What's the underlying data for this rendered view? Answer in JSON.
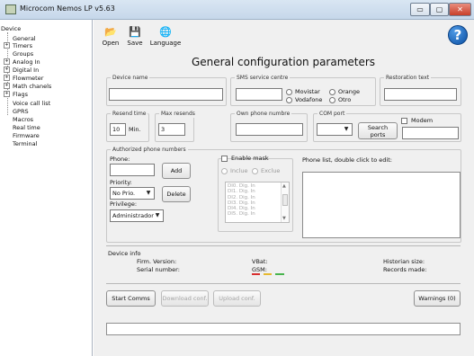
{
  "window": {
    "title": "Microcom Nemos LP v5.63",
    "controls": {
      "minimize": "▭",
      "maximize": "▢",
      "close": "✕"
    }
  },
  "tree": {
    "root": "Device",
    "items": [
      "General",
      "Timers",
      "Groups",
      "Analog In",
      "Digital In",
      "Flowmeter",
      "Math chanels",
      "Flags",
      "Voice call list",
      "GPRS",
      "Macros",
      "Real time",
      "Firmware",
      "Terminal"
    ]
  },
  "toolbar": {
    "open": "Open",
    "save": "Save",
    "language": "Language",
    "help": "?"
  },
  "page": {
    "heading": "General configuration parameters"
  },
  "device_name": {
    "label": "Device name",
    "value": ""
  },
  "sms_service": {
    "label": "SMS service centre",
    "value": "",
    "options": [
      "Movistar",
      "Orange",
      "Vodafone",
      "Otro"
    ]
  },
  "restoration": {
    "label": "Restoration text",
    "value": ""
  },
  "resend": {
    "label": "Resend time",
    "value": "10",
    "unit": "Min."
  },
  "max_resends": {
    "label": "Max resends",
    "value": "3"
  },
  "own_phone": {
    "label": "Own phone numbre",
    "value": ""
  },
  "com_port": {
    "label": "COM port",
    "value": "",
    "search_line1": "Search",
    "search_line2": "ports"
  },
  "modem": {
    "label": "Modem",
    "value": ""
  },
  "authorized": {
    "label": "Authorized phone numbers",
    "phone_label": "Phone:",
    "phone_value": "",
    "add": "Add",
    "priority_label": "Priority:",
    "priority_value": "No Prio.",
    "delete": "Delete",
    "privilege_label": "Privilege:",
    "privilege_value": "Administrador",
    "enable_mask": "Enable mask",
    "include": "Inclue",
    "exclude": "Exclue",
    "mask_items": [
      "DI0. Dig. In",
      "DI1. Dig. In",
      "DI2. Dig. In",
      "DI3. Dig. In",
      "DI4. Dig. In",
      "DI5. Dig. In"
    ],
    "phone_list_label": "Phone list, double click to edit:"
  },
  "device_info": {
    "label": "Device info",
    "firm_version_label": "Firm. Version:",
    "serial_label": "Serial number:",
    "vbat_label": "VBat:",
    "gsm_label": "GSM:",
    "historian_label": "Historian size:",
    "records_label": "Records made:"
  },
  "actions": {
    "start": "Start Comms",
    "download": "Download conf.",
    "upload": "Upload conf.",
    "warnings": "Warnings (0)"
  },
  "colors": {
    "gsm_segments": [
      "#d82f2f",
      "#e6b92f",
      "#48b44d"
    ],
    "help": "#1667c6"
  }
}
